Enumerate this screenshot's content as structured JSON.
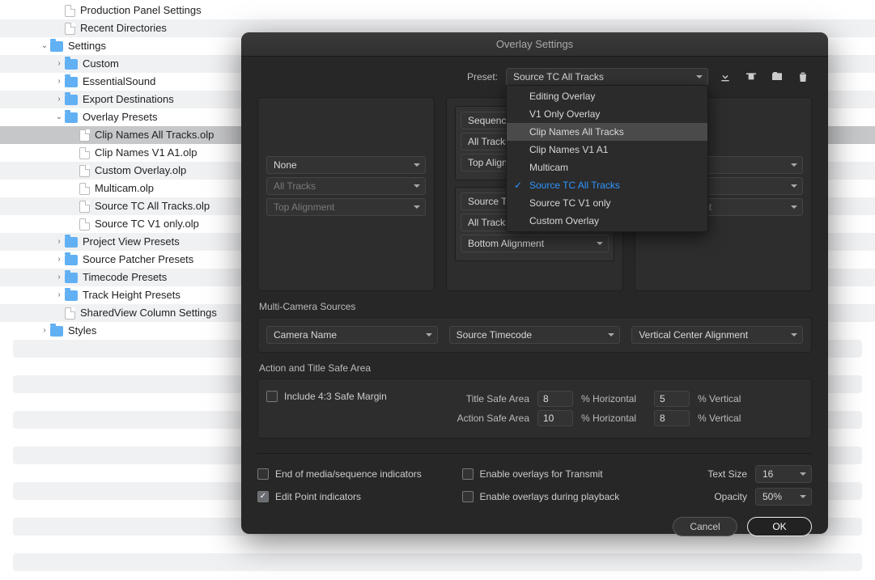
{
  "tree": [
    {
      "depth": 2,
      "kind": "file",
      "label": "Production Panel Settings"
    },
    {
      "depth": 2,
      "kind": "file",
      "label": "Recent Directories"
    },
    {
      "depth": 1,
      "kind": "folder",
      "label": "Settings",
      "expanded": true
    },
    {
      "depth": 2,
      "kind": "folder",
      "label": "Custom",
      "expanded": false
    },
    {
      "depth": 2,
      "kind": "folder",
      "label": "EssentialSound",
      "expanded": false
    },
    {
      "depth": 2,
      "kind": "folder",
      "label": "Export Destinations",
      "expanded": false
    },
    {
      "depth": 2,
      "kind": "folder",
      "label": "Overlay Presets",
      "expanded": true
    },
    {
      "depth": 3,
      "kind": "file",
      "label": "Clip Names All Tracks.olp",
      "selected": true
    },
    {
      "depth": 3,
      "kind": "file",
      "label": "Clip Names V1 A1.olp"
    },
    {
      "depth": 3,
      "kind": "file",
      "label": "Custom Overlay.olp"
    },
    {
      "depth": 3,
      "kind": "file",
      "label": "Multicam.olp"
    },
    {
      "depth": 3,
      "kind": "file",
      "label": "Source TC All Tracks.olp"
    },
    {
      "depth": 3,
      "kind": "file",
      "label": "Source TC V1 only.olp"
    },
    {
      "depth": 2,
      "kind": "folder",
      "label": "Project View Presets",
      "expanded": false
    },
    {
      "depth": 2,
      "kind": "folder",
      "label": "Source Patcher Presets",
      "expanded": false
    },
    {
      "depth": 2,
      "kind": "folder",
      "label": "Timecode Presets",
      "expanded": false
    },
    {
      "depth": 2,
      "kind": "folder",
      "label": "Track Height Presets",
      "expanded": false
    },
    {
      "depth": 2,
      "kind": "file",
      "label": "SharedView Column Settings"
    },
    {
      "depth": 1,
      "kind": "folder",
      "label": "Styles",
      "expanded": false
    }
  ],
  "dialog": {
    "title": "Overlay Settings",
    "preset_label": "Preset:",
    "preset_value": "Source TC All Tracks",
    "menu": [
      {
        "label": "Editing Overlay"
      },
      {
        "label": "V1 Only Overlay"
      },
      {
        "label": "Clip Names All Tracks",
        "hover": true
      },
      {
        "label": "Clip Names V1 A1"
      },
      {
        "label": "Multicam"
      },
      {
        "label": "Source TC All Tracks",
        "selected": true
      },
      {
        "label": "Source TC V1 only"
      },
      {
        "label": "Custom Overlay"
      }
    ],
    "panel_left": {
      "a": "None",
      "b": "All Tracks",
      "c": "Top Alignment"
    },
    "panel_mid_top": {
      "a": "Sequence Timecode",
      "b": "All Tracks",
      "c": "Top Alignment"
    },
    "panel_mid_bot": {
      "a": "Source Timecode",
      "b": "All Tracks",
      "c": "Bottom Alignment"
    },
    "panel_right": {
      "c": "Top Alignment"
    },
    "multicam_label": "Multi-Camera Sources",
    "multicam": {
      "a": "Camera Name",
      "b": "Source Timecode",
      "c": "Vertical Center Alignment"
    },
    "safe_label": "Action and Title Safe Area",
    "include_43": "Include 4:3 Safe Margin",
    "title_safe": "Title Safe Area",
    "action_safe": "Action Safe Area",
    "horiz": "% Horizontal",
    "vert": "% Vertical",
    "ts_h": "8",
    "ts_v": "5",
    "as_h": "10",
    "as_v": "8",
    "endmedia": "End of media/sequence indicators",
    "editpoint": "Edit Point indicators",
    "transmit": "Enable overlays for Transmit",
    "playback": "Enable overlays during playback",
    "textsize_label": "Text Size",
    "textsize": "16",
    "opacity_label": "Opacity",
    "opacity": "50%",
    "cancel": "Cancel",
    "ok": "OK"
  }
}
